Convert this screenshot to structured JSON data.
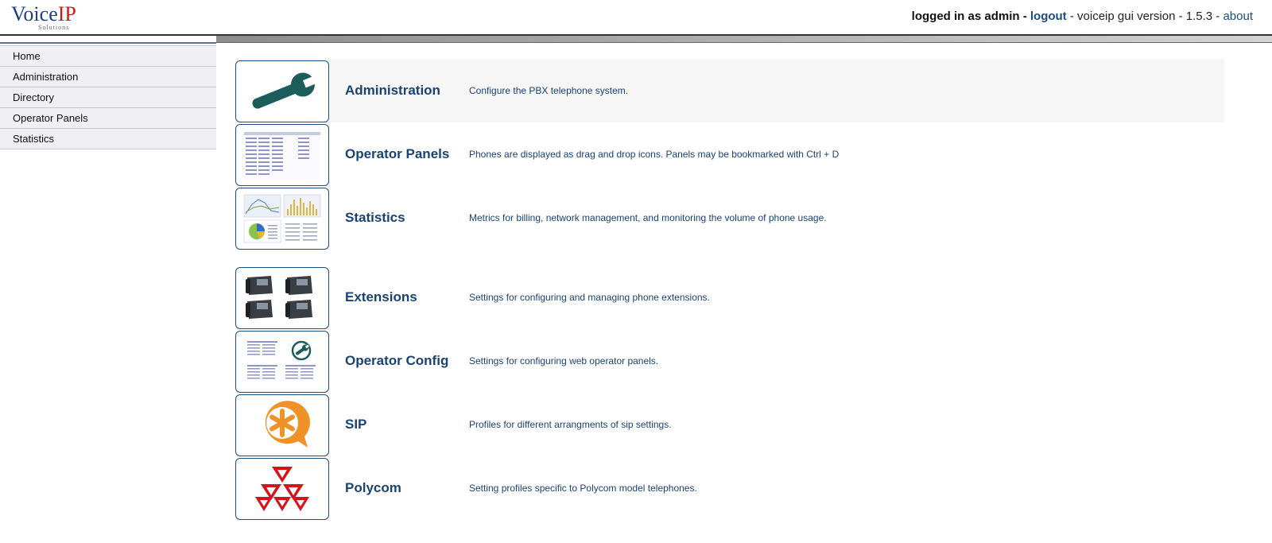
{
  "header": {
    "logo_text_voice": "Voice",
    "logo_text_ip": "IP",
    "logo_subtext": "Solutions",
    "logged_in_text": "logged in as admin -",
    "logout_label": "logout",
    "version_text": "- voiceip gui version - 1.5.3 -",
    "about_label": "about"
  },
  "sidebar": {
    "items": [
      {
        "label": "Home"
      },
      {
        "label": "Administration"
      },
      {
        "label": "Directory"
      },
      {
        "label": "Operator Panels"
      },
      {
        "label": "Statistics"
      }
    ]
  },
  "main": {
    "rows": [
      {
        "title": "Administration",
        "description": "Configure the PBX telephone system.",
        "icon": "wrench-icon",
        "highlighted": true
      },
      {
        "title": "Operator Panels",
        "description": "Phones are displayed as drag and drop icons. Panels may be bookmarked with Ctrl + D",
        "icon": "operator-panels-thumbnail"
      },
      {
        "title": "Statistics",
        "description": "Metrics for billing, network management, and monitoring the volume of phone usage.",
        "icon": "statistics-thumbnail"
      },
      {
        "title": "Extensions",
        "description": "Settings for configuring and managing phone extensions.",
        "icon": "desk-phones-icon"
      },
      {
        "title": "Operator Config",
        "description": "Settings for configuring web operator panels.",
        "icon": "operator-config-thumbnail"
      },
      {
        "title": "SIP",
        "description": "Profiles for different arrangments of sip settings.",
        "icon": "asterisk-icon"
      },
      {
        "title": "Polycom",
        "description": "Setting profiles specific to Polycom model telephones.",
        "icon": "polycom-logo-icon"
      }
    ]
  },
  "colors": {
    "link_blue": "#1a4c85",
    "title_blue": "#1a4273",
    "logo_voice": "#1e3d8a",
    "logo_ip": "#c91a1a",
    "wrench_green": "#1a5d5a",
    "sip_orange": "#f09228",
    "polycom_red": "#d4141a"
  }
}
